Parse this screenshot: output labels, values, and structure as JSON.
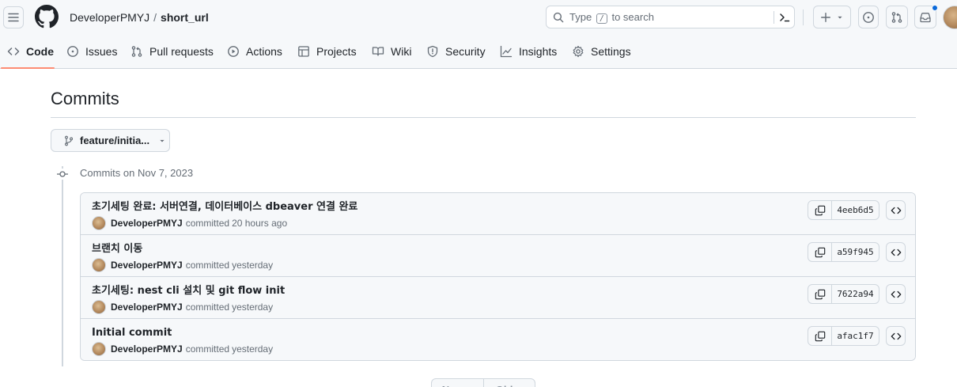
{
  "header": {
    "owner": "DeveloperPMYJ",
    "separator": "/",
    "repo": "short_url",
    "search": {
      "prefix": "Type",
      "key": "/",
      "suffix": "to search"
    },
    "icons": [
      "hamburger-icon",
      "github-logo-icon",
      "search-icon",
      "command-palette-icon",
      "plus-icon",
      "triangle-down-icon",
      "issue-opened-icon",
      "git-pull-request-icon",
      "inbox-icon"
    ],
    "accent": "#0969da"
  },
  "tabs": [
    {
      "label": "Code",
      "icon": "code-icon",
      "selected": true
    },
    {
      "label": "Issues",
      "icon": "issue-opened-icon"
    },
    {
      "label": "Pull requests",
      "icon": "git-pull-request-icon"
    },
    {
      "label": "Actions",
      "icon": "play-icon"
    },
    {
      "label": "Projects",
      "icon": "table-icon"
    },
    {
      "label": "Wiki",
      "icon": "book-icon"
    },
    {
      "label": "Security",
      "icon": "shield-icon"
    },
    {
      "label": "Insights",
      "icon": "graph-icon"
    },
    {
      "label": "Settings",
      "icon": "gear-icon"
    }
  ],
  "main": {
    "title": "Commits",
    "branch": "feature/initia...",
    "group_label": "Commits on Nov 7, 2023",
    "commits": [
      {
        "message": "초기세팅 완료: 서버연결, 데이터베이스 dbeaver 연결 완료",
        "author": "DeveloperPMYJ",
        "action": "committed",
        "time": "20 hours ago",
        "sha": "4eeb6d5"
      },
      {
        "message": "브랜치 이동",
        "author": "DeveloperPMYJ",
        "action": "committed",
        "time": "yesterday",
        "sha": "a59f945"
      },
      {
        "message": "초기세팅: nest cli 설치 및 git flow init",
        "author": "DeveloperPMYJ",
        "action": "committed",
        "time": "yesterday",
        "sha": "7622a94"
      },
      {
        "message": "Initial commit",
        "author": "DeveloperPMYJ",
        "action": "committed",
        "time": "yesterday",
        "sha": "afac1f7"
      }
    ],
    "pagination": {
      "newer": "Newer",
      "older": "Older"
    }
  }
}
